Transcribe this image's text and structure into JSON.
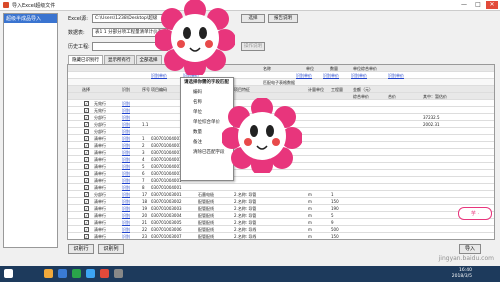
{
  "window": {
    "title": "导入Excel超级文件",
    "min": "—",
    "max": "□",
    "close": "✕"
  },
  "sidebar": {
    "items": [
      {
        "label": "超级半成品导入"
      }
    ]
  },
  "form": {
    "excel_label": "Excel源:",
    "excel_value": "C:\\Users\\1238\\Desktop\\超级",
    "select_btn": "选择",
    "report_btn": "报告说明",
    "data_label": "数据表:",
    "data_value": "表1 1 分部分项工程量清单计价表",
    "history_label": "历史工程:",
    "ops_btn": "操作说明"
  },
  "tabs": [
    "隐藏已识别行",
    "显示所有行",
    "全部选择"
  ],
  "grid": {
    "top_headers": [
      "名称",
      "单位",
      "数量",
      "单位综合单价"
    ],
    "link_row": [
      "识别单价",
      "识别单价",
      "识别单价",
      "识别单价",
      "识别单价",
      "识别单价"
    ],
    "col_headers": [
      "选择",
      "识别",
      "序号",
      "项目编码",
      "项目名称",
      "项目特征",
      "计量单位",
      "工程量",
      "金额（元）"
    ],
    "sub_headers": [
      "综合单价",
      "合价",
      "其中：暂估价"
    ],
    "rows": [
      {
        "chk": "✓",
        "type": "无效行",
        "act": "识别",
        "seq": "",
        "code": "",
        "name": "",
        "unit": "",
        "qty": "",
        "price": ""
      },
      {
        "chk": "✓",
        "type": "无效行",
        "act": "识别",
        "seq": "",
        "code": "",
        "name": "",
        "unit": "",
        "qty": "",
        "price": ""
      },
      {
        "chk": "✓",
        "type": "分部行",
        "act": "识别",
        "seq": "",
        "code": "",
        "name": "",
        "unit": "",
        "qty": "",
        "price": "37232.5"
      },
      {
        "chk": "✓",
        "type": "分部行",
        "act": "识别",
        "seq": "1.1",
        "code": "",
        "name": "",
        "unit": "",
        "qty": "",
        "price": "2002.31"
      },
      {
        "chk": "✓",
        "type": "分部行",
        "act": "识别",
        "seq": "",
        "code": "",
        "name": "",
        "unit": "",
        "qty": "",
        "price": ""
      },
      {
        "chk": "✓",
        "type": "清单行",
        "act": "识别",
        "seq": "1",
        "code": "030701004001",
        "name": "",
        "unit": "",
        "qty": "",
        "price": ""
      },
      {
        "chk": "✓",
        "type": "清单行",
        "act": "识别",
        "seq": "2",
        "code": "030701004001",
        "name": "",
        "unit": "",
        "qty": "",
        "price": ""
      },
      {
        "chk": "✓",
        "type": "清单行",
        "act": "识别",
        "seq": "3",
        "code": "030701004001",
        "name": "",
        "unit": "",
        "qty": "",
        "price": ""
      },
      {
        "chk": "✓",
        "type": "清单行",
        "act": "识别",
        "seq": "4",
        "code": "030701004001",
        "name": "",
        "unit": "",
        "qty": "",
        "price": ""
      },
      {
        "chk": "✓",
        "type": "清单行",
        "act": "识别",
        "seq": "5",
        "code": "030701004001",
        "name": "",
        "unit": "",
        "qty": "",
        "price": ""
      },
      {
        "chk": "✓",
        "type": "清单行",
        "act": "识别",
        "seq": "6",
        "code": "030701004001",
        "name": "",
        "unit": "",
        "qty": "",
        "price": ""
      },
      {
        "chk": "✓",
        "type": "清单行",
        "act": "识别",
        "seq": "7",
        "code": "030701004001",
        "name": "",
        "unit": "",
        "qty": "",
        "price": ""
      },
      {
        "chk": "✓",
        "type": "清单行",
        "act": "识别",
        "seq": "8",
        "code": "030701004001",
        "name": "",
        "unit": "",
        "qty": "",
        "price": ""
      },
      {
        "chk": "✓",
        "type": "清单行",
        "act": "识别",
        "seq": "9",
        "code": "030701004001",
        "name": "",
        "unit": "",
        "qty": "",
        "price": ""
      },
      {
        "chk": "✓",
        "type": "清单行",
        "act": "识别",
        "seq": "10",
        "code": "030701004001",
        "name": "",
        "unit": "",
        "qty": "",
        "price": ""
      },
      {
        "chk": "✓",
        "type": "清单行",
        "act": "识别",
        "seq": "11",
        "code": "030701004001",
        "name": "",
        "unit": "",
        "qty": "",
        "price": ""
      },
      {
        "chk": "✓",
        "type": "清单行",
        "act": "识别",
        "seq": "12",
        "code": "030701004001",
        "name": "",
        "unit": "",
        "qty": "",
        "price": ""
      },
      {
        "chk": "✓",
        "type": "清单行",
        "act": "识别",
        "seq": "13",
        "code": "030701004001",
        "name": "",
        "unit": "",
        "qty": "",
        "price": ""
      },
      {
        "chk": "✓",
        "type": "清单行",
        "act": "识别",
        "seq": "14",
        "code": "030701004001",
        "name": "",
        "unit": "",
        "qty": "",
        "price": ""
      },
      {
        "chk": "✓",
        "type": "清单行",
        "act": "识别",
        "seq": "15",
        "code": "030701004001",
        "name": "",
        "unit": "",
        "qty": "",
        "price": ""
      },
      {
        "chk": "",
        "type": "",
        "act": "",
        "seq": "",
        "code": "",
        "name": "",
        "unit": "",
        "qty": "",
        "price": ""
      },
      {
        "chk": "",
        "type": "",
        "act": "",
        "seq": "",
        "code": "",
        "name": "",
        "unit": "",
        "qty": "",
        "price": ""
      },
      {
        "chk": "",
        "type": "",
        "act": "",
        "seq": "",
        "code": "",
        "name": "",
        "unit": "",
        "qty": "",
        "price": ""
      },
      {
        "chk": "",
        "type": "",
        "act": "",
        "seq": "",
        "code": "",
        "name": "",
        "unit": "",
        "qty": "",
        "price": ""
      },
      {
        "chk": "",
        "type": "",
        "act": "",
        "seq": "",
        "code": "",
        "name": "",
        "unit": "",
        "qty": "",
        "price": ""
      },
      {
        "chk": "",
        "type": "",
        "act": "",
        "seq": "",
        "code": "",
        "name": "",
        "unit": "",
        "qty": "",
        "price": ""
      },
      {
        "chk": "",
        "type": "",
        "act": "",
        "seq": "",
        "code": "",
        "name": "",
        "unit": "",
        "qty": "",
        "price": ""
      }
    ],
    "middle_rows": [
      {
        "chk": "✓",
        "type": "分部行",
        "act": "识别",
        "seq": "17",
        "code": "030701003001",
        "name": "石墨电极",
        "fullname": "2.名称: 导管",
        "unit": "m",
        "qty": "1"
      },
      {
        "chk": "✓",
        "type": "清单行",
        "act": "识别",
        "seq": "18",
        "code": "030701003002",
        "name": "配管配线",
        "fullname": "2.名称: 导管",
        "unit": "m",
        "qty": "150"
      },
      {
        "chk": "✓",
        "type": "清单行",
        "act": "识别",
        "seq": "19",
        "code": "030701003003",
        "name": "配管配线",
        "fullname": "2.名称: 导管",
        "unit": "m",
        "qty": "190"
      },
      {
        "chk": "✓",
        "type": "清单行",
        "act": "识别",
        "seq": "20",
        "code": "030701003004",
        "name": "配管配线",
        "fullname": "2.名称: 导管",
        "unit": "m",
        "qty": "5"
      },
      {
        "chk": "✓",
        "type": "清单行",
        "act": "识别",
        "seq": "21",
        "code": "030701003005",
        "name": "配管配线",
        "fullname": "2.名称: 导管",
        "unit": "m",
        "qty": "9"
      },
      {
        "chk": "✓",
        "type": "清单行",
        "act": "识别",
        "seq": "22",
        "code": "030701003006",
        "name": "配管配线",
        "fullname": "2.名称: 导线",
        "unit": "m",
        "qty": "500"
      },
      {
        "chk": "✓",
        "type": "清单行",
        "act": "识别",
        "seq": "23",
        "code": "030701003007",
        "name": "配管配线",
        "fullname": "2.名称: 导线",
        "unit": "m",
        "qty": "150"
      }
    ]
  },
  "context_menu": {
    "title": "请选择你需的字段匹配",
    "items": [
      "编码",
      "名称",
      "单位",
      "单位综合单价",
      "数量",
      "备注",
      "清除已匹配字段"
    ]
  },
  "grid_title": "匹配电子表格数据",
  "bottom": {
    "btn1": "识别行",
    "btn2": "识别列",
    "btn3": "导入"
  },
  "taskbar": {
    "time": "16:40",
    "date": "2018/3/5"
  },
  "watermark": "jingyan.baidu.com",
  "flower_badge": "芋 · ",
  "colors": {
    "accent": "#3a74d0",
    "link": "#2244cc",
    "taskbar": "#1d3a5c"
  }
}
